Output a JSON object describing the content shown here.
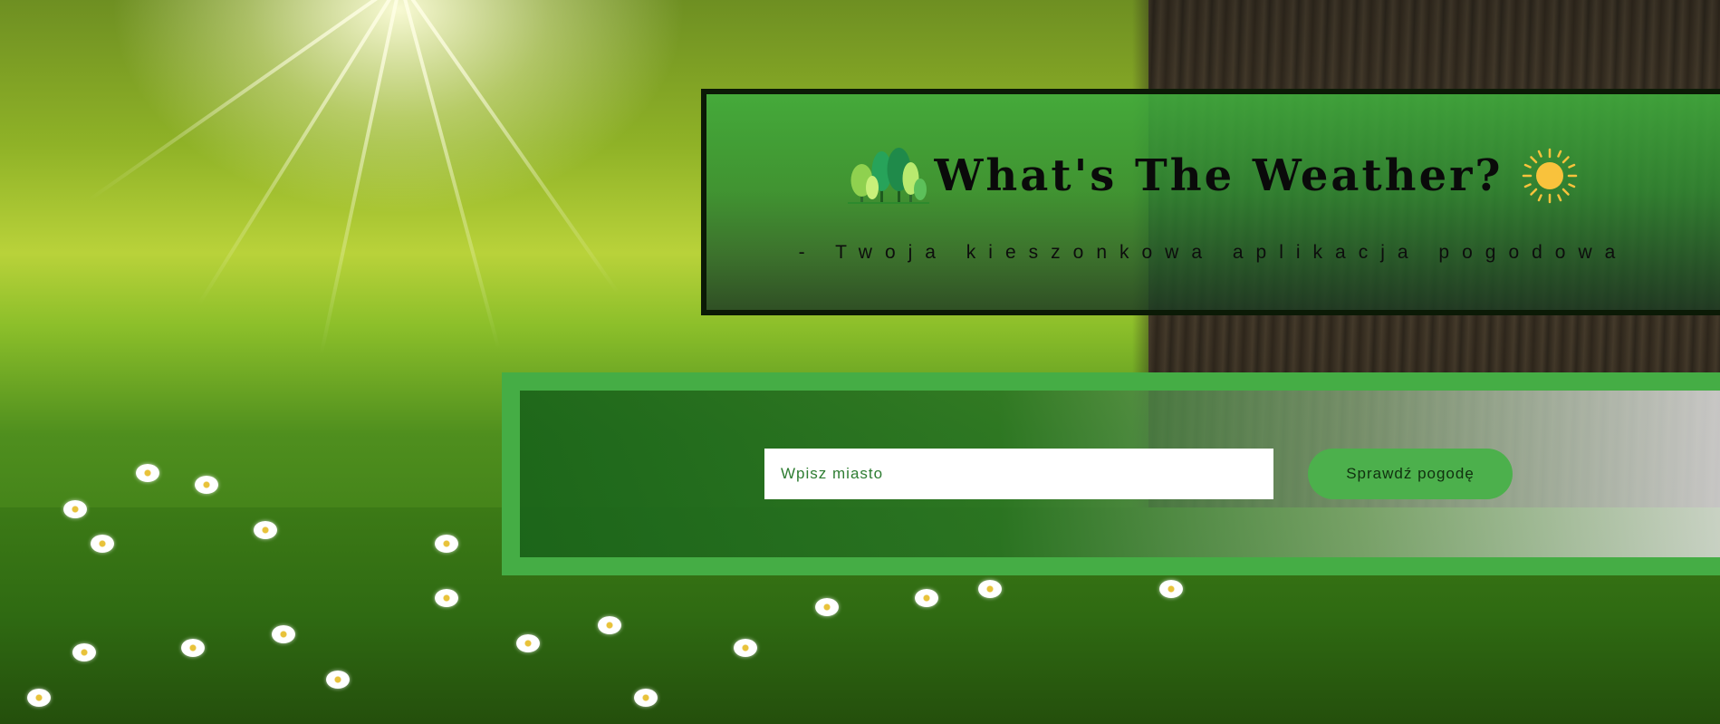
{
  "header": {
    "title": "What's The Weather?",
    "subtitle": "- Twoja kieszonkowa aplikacja pogodowa"
  },
  "icons": {
    "left": "trees-icon",
    "right": "sun-icon"
  },
  "search": {
    "placeholder": "Wpisz miasto",
    "button_label": "Sprawdź pogodę"
  },
  "colors": {
    "header_panel": "#40aa3c",
    "header_border": "#0b1a06",
    "search_border": "#45ad45",
    "button_bg": "#4cb04c",
    "input_text": "#2e7d32",
    "sun": "#f9c23c"
  }
}
